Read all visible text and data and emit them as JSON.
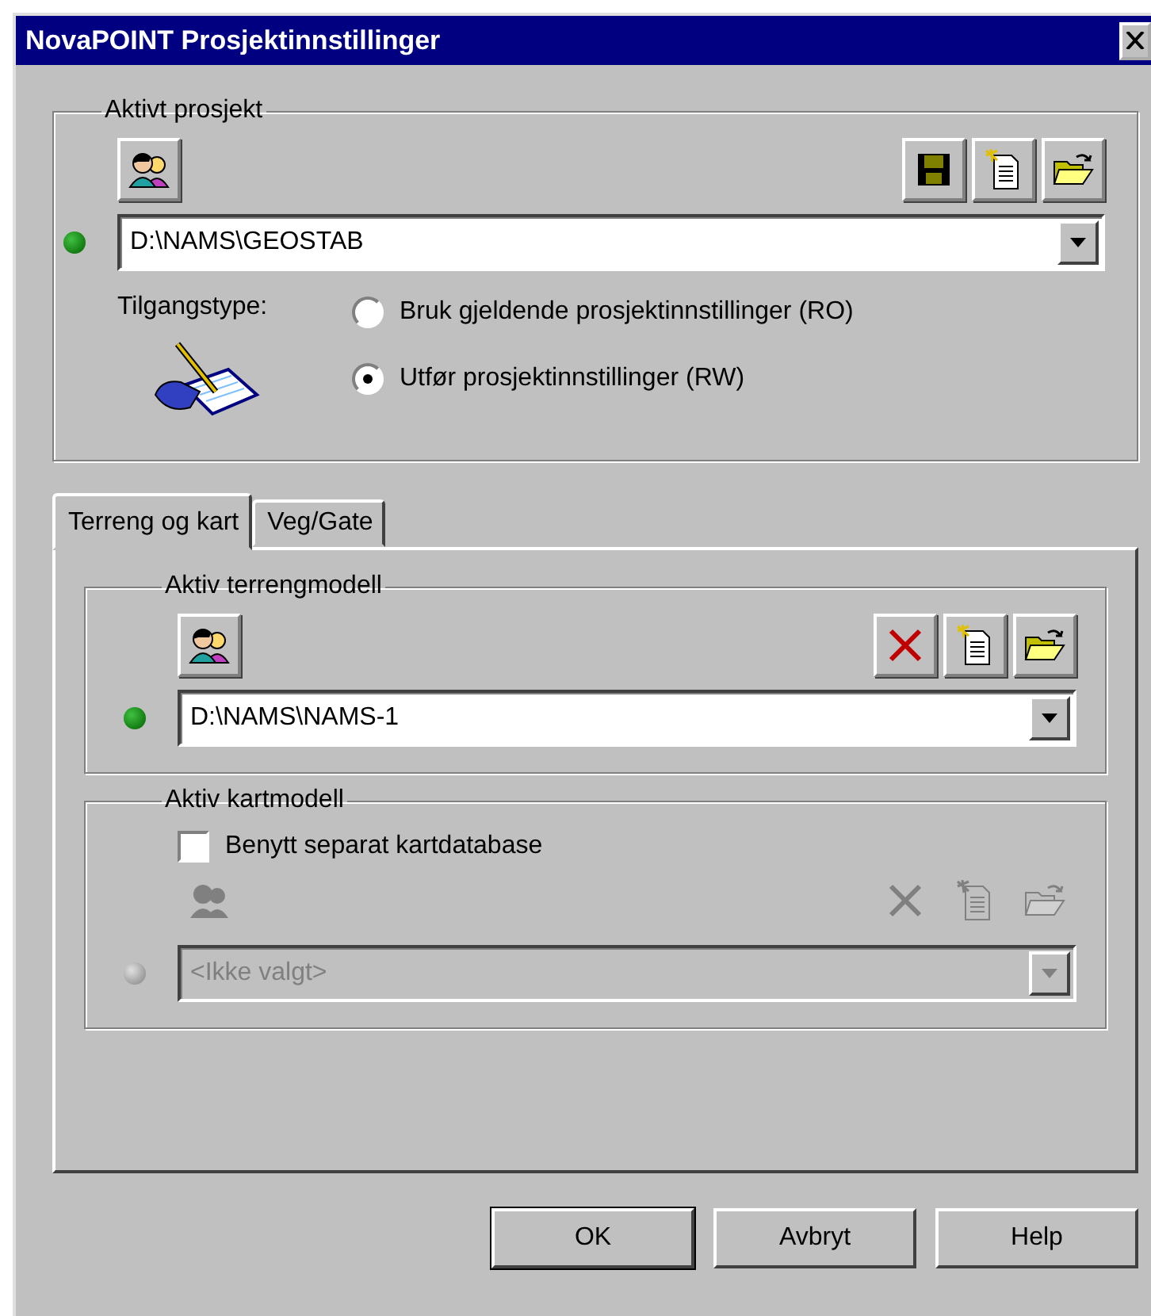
{
  "window": {
    "title": "NovaPOINT Prosjektinnstillinger"
  },
  "project": {
    "label": "Aktivt prosjekt",
    "path": "D:\\NAMS\\GEOSTAB",
    "disabled": false,
    "tools": [
      {
        "kind": "save",
        "disabled": false
      },
      {
        "kind": "new",
        "disabled": false
      },
      {
        "kind": "open",
        "disabled": false
      }
    ],
    "access_label": "Tilgangstype:",
    "access_options": [
      {
        "label": "Bruk gjeldende prosjektinnstillinger (RO)",
        "selected": false
      },
      {
        "label": "Utfør prosjektinnstillinger (RW)",
        "selected": true
      }
    ]
  },
  "tabs": [
    {
      "label": "Terreng og kart",
      "selected": true
    },
    {
      "label": "Veg/Gate",
      "selected": false
    }
  ],
  "models": [
    {
      "label": "Aktiv terrengmodell",
      "path": "D:\\NAMS\\NAMS-1",
      "disabled": false,
      "tools": [
        {
          "kind": "delete",
          "disabled": false
        },
        {
          "kind": "new",
          "disabled": false
        },
        {
          "kind": "open",
          "disabled": false
        }
      ]
    },
    {
      "label": "Aktiv kartmodell",
      "checkbox": {
        "label": "Benytt separat kartdatabase",
        "checked": false
      },
      "path": "<Ikke valgt>",
      "disabled": true,
      "tools": [
        {
          "kind": "delete",
          "disabled": true
        },
        {
          "kind": "new",
          "disabled": true
        },
        {
          "kind": "open",
          "disabled": true
        }
      ]
    }
  ],
  "buttons": [
    "OK",
    "Avbryt",
    "Help"
  ]
}
